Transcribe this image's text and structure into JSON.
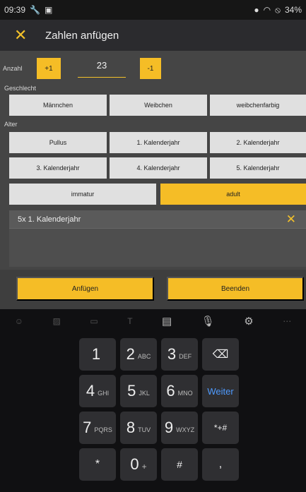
{
  "status_bar": {
    "time": "09:39",
    "battery": "34%"
  },
  "app_bar": {
    "title": "Zahlen anfügen"
  },
  "anzahl": {
    "label": "Anzahl",
    "plus_label": "+1",
    "value": "23",
    "minus_label": "-1"
  },
  "geschlecht": {
    "label": "Geschlecht",
    "options": [
      "Männchen",
      "Weibchen",
      "weibchenfarbig"
    ]
  },
  "alter": {
    "label": "Alter",
    "options": [
      "Pullus",
      "1. Kalenderjahr",
      "2. Kalenderjahr",
      "3. Kalenderjahr",
      "4. Kalenderjahr",
      "5. Kalenderjahr"
    ]
  },
  "reife": {
    "options": [
      "immatur",
      "adult"
    ],
    "selected": "adult"
  },
  "entries": [
    {
      "text": "5x 1. Kalenderjahr"
    }
  ],
  "actions": {
    "append": "Anfügen",
    "finish": "Beenden"
  },
  "keyboard": {
    "keys": [
      {
        "main": "1",
        "sub": ""
      },
      {
        "main": "2",
        "sub": "ABC"
      },
      {
        "main": "3",
        "sub": "DEF"
      },
      {
        "main": "4",
        "sub": "GHI"
      },
      {
        "main": "5",
        "sub": "JKL"
      },
      {
        "main": "6",
        "sub": "MNO"
      },
      {
        "main": "7",
        "sub": "PQRS"
      },
      {
        "main": "8",
        "sub": "TUV"
      },
      {
        "main": "9",
        "sub": "WXYZ"
      },
      {
        "main": "*",
        "sub": ""
      },
      {
        "main": "0",
        "sub": "+"
      },
      {
        "main": "#",
        "sub": ""
      }
    ],
    "side_keys": {
      "backspace": "⌫",
      "next": "Weiter",
      "symbols": "*+#",
      "comma": ","
    }
  },
  "colors": {
    "accent": "#f5bd26",
    "panel": "#454545",
    "appbar": "#2b2b2e"
  }
}
